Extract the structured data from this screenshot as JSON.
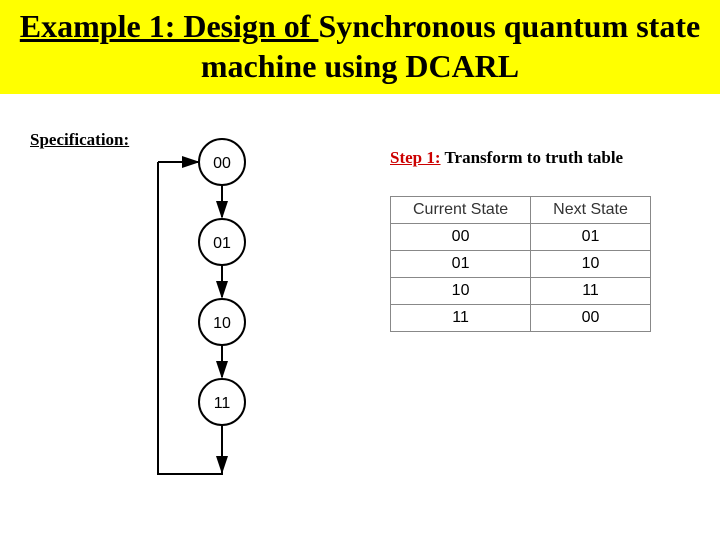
{
  "title": {
    "underlined": "Example 1: Design of ",
    "rest": "Synchronous quantum state machine using DCARL"
  },
  "specification_label": "Specification",
  "state_diagram": {
    "nodes": [
      "00",
      "01",
      "10",
      "11"
    ]
  },
  "step": {
    "prefix": "Step 1:",
    "text": " Transform to truth table"
  },
  "table": {
    "headers": [
      "Current State",
      "Next State"
    ],
    "rows": [
      [
        "00",
        "01"
      ],
      [
        "01",
        "10"
      ],
      [
        "10",
        "11"
      ],
      [
        "11",
        "00"
      ]
    ]
  },
  "chart_data": {
    "type": "table",
    "title": "State transition truth table",
    "headers": [
      "Current State",
      "Next State"
    ],
    "rows": [
      [
        "00",
        "01"
      ],
      [
        "01",
        "10"
      ],
      [
        "10",
        "11"
      ],
      [
        "11",
        "00"
      ]
    ]
  }
}
